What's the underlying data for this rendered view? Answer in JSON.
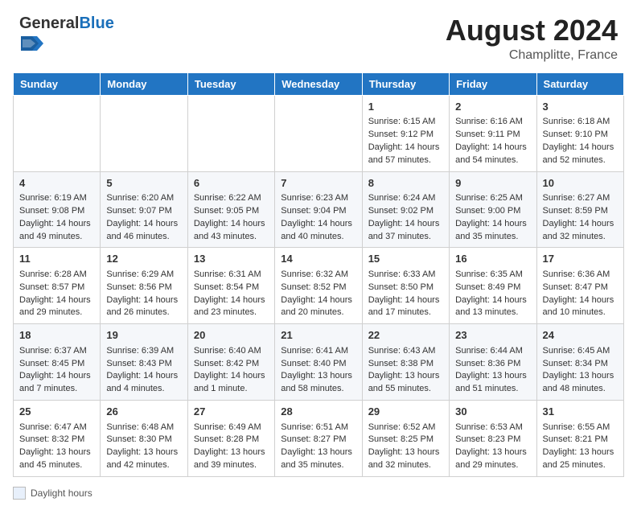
{
  "header": {
    "logo_general": "General",
    "logo_blue": "Blue",
    "month_year": "August 2024",
    "location": "Champlitte, France"
  },
  "legend": {
    "label": "Daylight hours"
  },
  "days_of_week": [
    "Sunday",
    "Monday",
    "Tuesday",
    "Wednesday",
    "Thursday",
    "Friday",
    "Saturday"
  ],
  "weeks": [
    {
      "days": [
        {
          "num": "",
          "info": ""
        },
        {
          "num": "",
          "info": ""
        },
        {
          "num": "",
          "info": ""
        },
        {
          "num": "",
          "info": ""
        },
        {
          "num": "1",
          "info": "Sunrise: 6:15 AM\nSunset: 9:12 PM\nDaylight: 14 hours and 57 minutes."
        },
        {
          "num": "2",
          "info": "Sunrise: 6:16 AM\nSunset: 9:11 PM\nDaylight: 14 hours and 54 minutes."
        },
        {
          "num": "3",
          "info": "Sunrise: 6:18 AM\nSunset: 9:10 PM\nDaylight: 14 hours and 52 minutes."
        }
      ]
    },
    {
      "days": [
        {
          "num": "4",
          "info": "Sunrise: 6:19 AM\nSunset: 9:08 PM\nDaylight: 14 hours and 49 minutes."
        },
        {
          "num": "5",
          "info": "Sunrise: 6:20 AM\nSunset: 9:07 PM\nDaylight: 14 hours and 46 minutes."
        },
        {
          "num": "6",
          "info": "Sunrise: 6:22 AM\nSunset: 9:05 PM\nDaylight: 14 hours and 43 minutes."
        },
        {
          "num": "7",
          "info": "Sunrise: 6:23 AM\nSunset: 9:04 PM\nDaylight: 14 hours and 40 minutes."
        },
        {
          "num": "8",
          "info": "Sunrise: 6:24 AM\nSunset: 9:02 PM\nDaylight: 14 hours and 37 minutes."
        },
        {
          "num": "9",
          "info": "Sunrise: 6:25 AM\nSunset: 9:00 PM\nDaylight: 14 hours and 35 minutes."
        },
        {
          "num": "10",
          "info": "Sunrise: 6:27 AM\nSunset: 8:59 PM\nDaylight: 14 hours and 32 minutes."
        }
      ]
    },
    {
      "days": [
        {
          "num": "11",
          "info": "Sunrise: 6:28 AM\nSunset: 8:57 PM\nDaylight: 14 hours and 29 minutes."
        },
        {
          "num": "12",
          "info": "Sunrise: 6:29 AM\nSunset: 8:56 PM\nDaylight: 14 hours and 26 minutes."
        },
        {
          "num": "13",
          "info": "Sunrise: 6:31 AM\nSunset: 8:54 PM\nDaylight: 14 hours and 23 minutes."
        },
        {
          "num": "14",
          "info": "Sunrise: 6:32 AM\nSunset: 8:52 PM\nDaylight: 14 hours and 20 minutes."
        },
        {
          "num": "15",
          "info": "Sunrise: 6:33 AM\nSunset: 8:50 PM\nDaylight: 14 hours and 17 minutes."
        },
        {
          "num": "16",
          "info": "Sunrise: 6:35 AM\nSunset: 8:49 PM\nDaylight: 14 hours and 13 minutes."
        },
        {
          "num": "17",
          "info": "Sunrise: 6:36 AM\nSunset: 8:47 PM\nDaylight: 14 hours and 10 minutes."
        }
      ]
    },
    {
      "days": [
        {
          "num": "18",
          "info": "Sunrise: 6:37 AM\nSunset: 8:45 PM\nDaylight: 14 hours and 7 minutes."
        },
        {
          "num": "19",
          "info": "Sunrise: 6:39 AM\nSunset: 8:43 PM\nDaylight: 14 hours and 4 minutes."
        },
        {
          "num": "20",
          "info": "Sunrise: 6:40 AM\nSunset: 8:42 PM\nDaylight: 14 hours and 1 minute."
        },
        {
          "num": "21",
          "info": "Sunrise: 6:41 AM\nSunset: 8:40 PM\nDaylight: 13 hours and 58 minutes."
        },
        {
          "num": "22",
          "info": "Sunrise: 6:43 AM\nSunset: 8:38 PM\nDaylight: 13 hours and 55 minutes."
        },
        {
          "num": "23",
          "info": "Sunrise: 6:44 AM\nSunset: 8:36 PM\nDaylight: 13 hours and 51 minutes."
        },
        {
          "num": "24",
          "info": "Sunrise: 6:45 AM\nSunset: 8:34 PM\nDaylight: 13 hours and 48 minutes."
        }
      ]
    },
    {
      "days": [
        {
          "num": "25",
          "info": "Sunrise: 6:47 AM\nSunset: 8:32 PM\nDaylight: 13 hours and 45 minutes."
        },
        {
          "num": "26",
          "info": "Sunrise: 6:48 AM\nSunset: 8:30 PM\nDaylight: 13 hours and 42 minutes."
        },
        {
          "num": "27",
          "info": "Sunrise: 6:49 AM\nSunset: 8:28 PM\nDaylight: 13 hours and 39 minutes."
        },
        {
          "num": "28",
          "info": "Sunrise: 6:51 AM\nSunset: 8:27 PM\nDaylight: 13 hours and 35 minutes."
        },
        {
          "num": "29",
          "info": "Sunrise: 6:52 AM\nSunset: 8:25 PM\nDaylight: 13 hours and 32 minutes."
        },
        {
          "num": "30",
          "info": "Sunrise: 6:53 AM\nSunset: 8:23 PM\nDaylight: 13 hours and 29 minutes."
        },
        {
          "num": "31",
          "info": "Sunrise: 6:55 AM\nSunset: 8:21 PM\nDaylight: 13 hours and 25 minutes."
        }
      ]
    }
  ]
}
